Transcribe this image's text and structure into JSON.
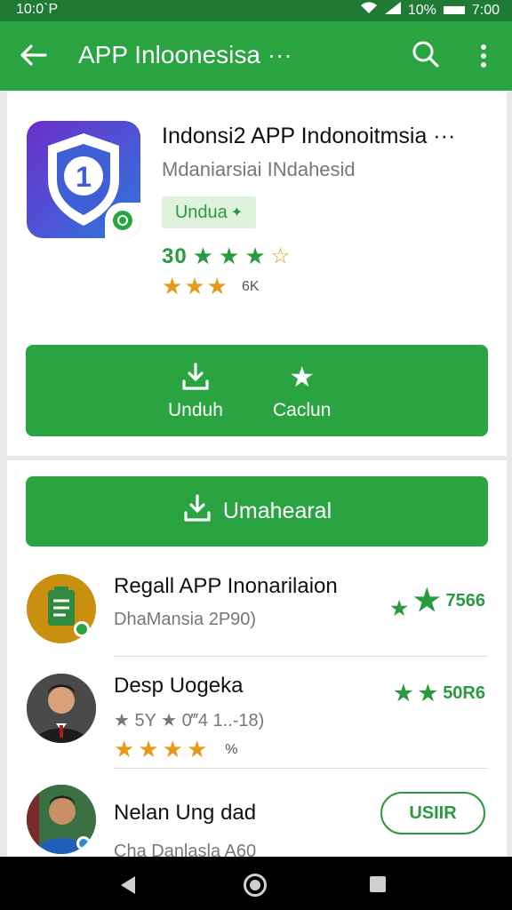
{
  "status_bar": {
    "time": "10:0`P",
    "battery": "10%",
    "clock": "7:00"
  },
  "app_bar": {
    "title": "APP Inloonesisa ···"
  },
  "app": {
    "title": "Indonsi2 APP Indonoitmsia ···",
    "developer": "Mdaniarsiai INdahesid",
    "tag": "Undua",
    "rating": "30",
    "rating_stars": 3.5,
    "orange_stars": 3,
    "orange_label": "6K",
    "actions": [
      {
        "label": "Unduh",
        "icon": "download-icon"
      },
      {
        "label": "Caclun",
        "icon": "star-icon"
      }
    ]
  },
  "primary_button": {
    "label": "Umahearal",
    "icon": "download-icon"
  },
  "list": [
    {
      "name": "Regall APP Inonarilaion",
      "sub": "DhaMansia 2P90)",
      "score": "7566",
      "avatar": "clipboard-icon"
    },
    {
      "name": "Desp Uogeka",
      "sub": "★ 5Y ★ 0‴4 1..-18)",
      "sub2": "%",
      "orange_stars": 4,
      "score": "50R6",
      "avatar": "person-avatar"
    },
    {
      "name": "Nelan Ung dad",
      "sub": "Cha Danlasla A60",
      "button": "USIIR",
      "avatar": "person-avatar"
    }
  ],
  "colors": {
    "primary": "#2aa341",
    "dark": "#1f7a33",
    "accent": "#e59a1c"
  }
}
